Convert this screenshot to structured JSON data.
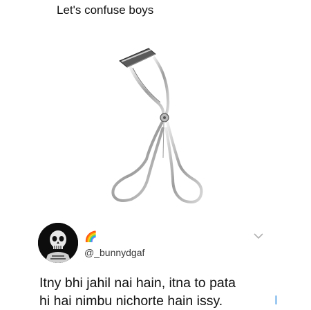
{
  "post": {
    "caption": "Let's confuse boys",
    "image_subject": "eyelash curler"
  },
  "reply": {
    "avatar_icon": "skull-avatar",
    "emoji": "🌈",
    "handle": "@_bunnydgaf",
    "text_line1": "Itny bhi jahil nai hain, itna to pata",
    "text_line2": "hi hai nimbu nichorte hain issy."
  },
  "icons": {
    "menu": "chevron-down-icon"
  },
  "colors": {
    "text": "#14171a",
    "handle": "#3a3a3a",
    "chevron": "#b0b0b0"
  }
}
